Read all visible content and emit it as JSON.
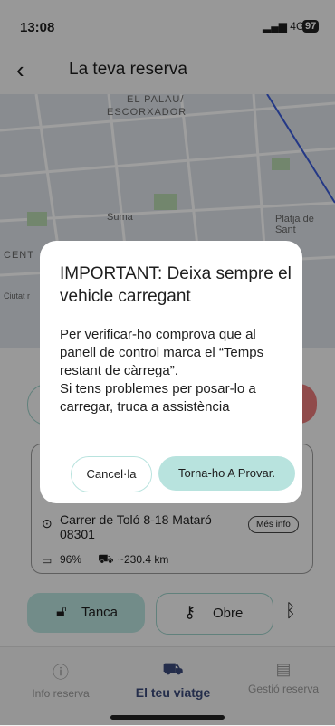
{
  "status": {
    "time": "13:08",
    "network": "4G",
    "battery": "97"
  },
  "header": {
    "back_icon": "‹",
    "title": "La teva reserva"
  },
  "map": {
    "labels": [
      "EL PALAU/",
      "ESCORXADOR",
      "Suma",
      "Platja de Sant",
      "CENT",
      "Ciutat r"
    ]
  },
  "card": {
    "address": "Carrer de Toló 8-18 Mataró 08301",
    "more_info": "Més info",
    "battery": "96%",
    "range": "~230.4 km"
  },
  "actions": {
    "lock": "Tanca",
    "open": "Obre"
  },
  "nav": {
    "items": [
      {
        "label": "Info reserva"
      },
      {
        "label": "El teu viatge"
      },
      {
        "label": "Gestió reserva"
      }
    ]
  },
  "dialog": {
    "title": "IMPORTANT: Deixa sempre el vehicle carregant",
    "body_1": "Per verificar-ho comprova que al panell de control marca el “Temps restant de càrrega”.",
    "body_2": "Si tens problemes per posar-lo a carregar, truca a assistència",
    "cancel": "Cancel·la",
    "retry": "Torna-ho A Provar."
  },
  "colors": {
    "accent": "#b8e3de",
    "danger": "#e97a7a",
    "nav_active": "#3a4a7a"
  }
}
